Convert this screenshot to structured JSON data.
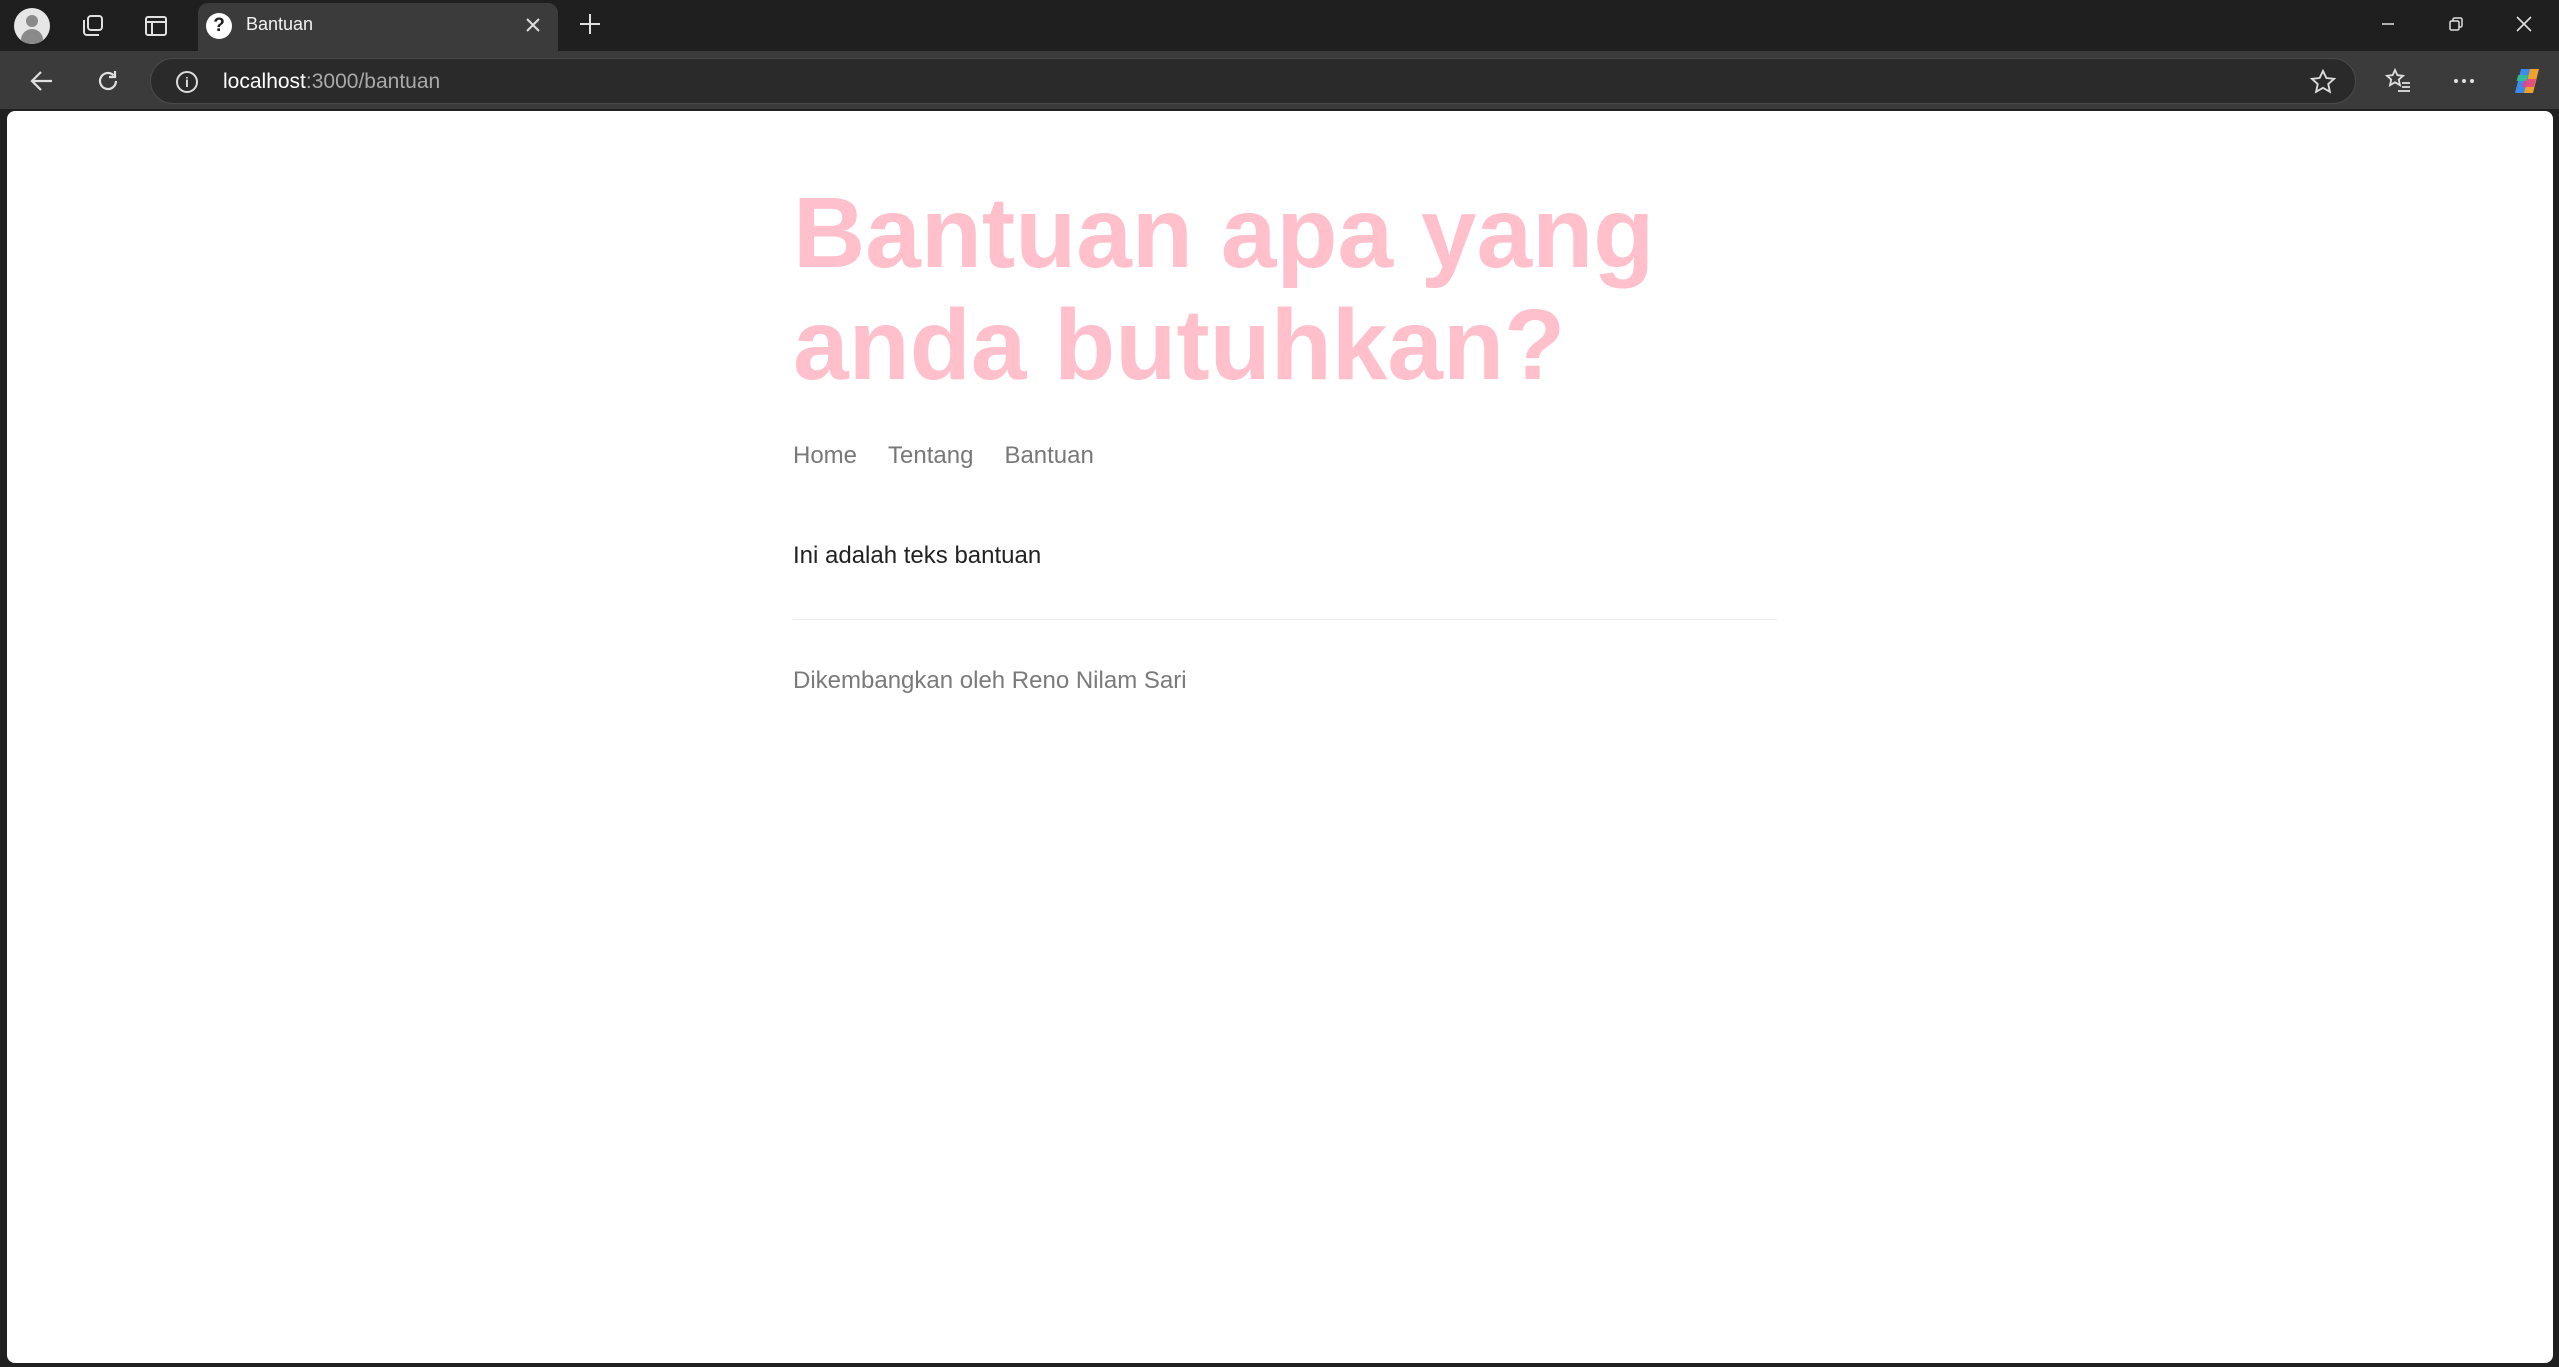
{
  "browser": {
    "tab_title": "Bantuan",
    "url_host": "localhost",
    "url_path": ":3000/bantuan"
  },
  "page": {
    "heading": "Bantuan apa yang anda butuhkan?",
    "nav": [
      {
        "label": "Home"
      },
      {
        "label": "Tentang"
      },
      {
        "label": "Bantuan"
      }
    ],
    "body_text": "Ini adalah teks bantuan",
    "footer": "Dikembangkan oleh Reno Nilam Sari"
  },
  "colors": {
    "heading": "#ffc0cb",
    "nav_link": "#787878",
    "body_text": "#222222",
    "footer_text": "#7a7a7a",
    "browser_chrome": "#1f1f1f"
  }
}
